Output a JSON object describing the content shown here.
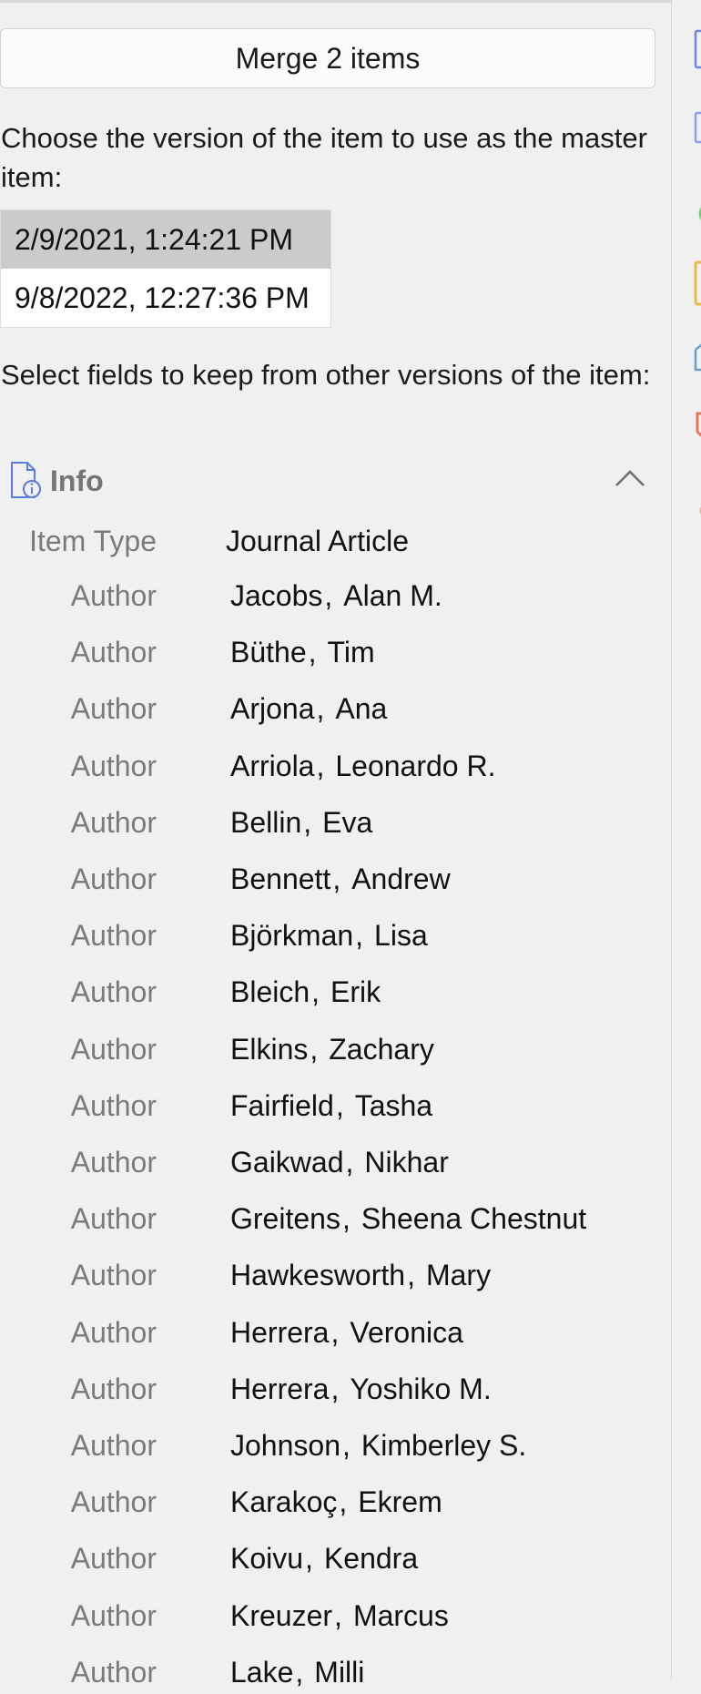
{
  "merge_button_label": "Merge 2 items",
  "master_prompt": "Choose the version of the item to use as the master item:",
  "versions": [
    {
      "label": "2/9/2021, 1:24:21 PM",
      "selected": true
    },
    {
      "label": "9/8/2022, 12:27:36 PM",
      "selected": false
    }
  ],
  "fields_prompt": "Select fields to keep from other versions of the item:",
  "info_section": {
    "title": "Info",
    "item_type_label": "Item Type",
    "item_type_value": "Journal Article",
    "author_label": "Author",
    "authors": [
      {
        "last": "Jacobs",
        "first": "Alan M."
      },
      {
        "last": "Büthe",
        "first": "Tim"
      },
      {
        "last": "Arjona",
        "first": "Ana"
      },
      {
        "last": "Arriola",
        "first": "Leonardo R."
      },
      {
        "last": "Bellin",
        "first": "Eva"
      },
      {
        "last": "Bennett",
        "first": "Andrew"
      },
      {
        "last": "Björkman",
        "first": "Lisa"
      },
      {
        "last": "Bleich",
        "first": "Erik"
      },
      {
        "last": "Elkins",
        "first": "Zachary"
      },
      {
        "last": "Fairfield",
        "first": "Tasha"
      },
      {
        "last": "Gaikwad",
        "first": "Nikhar"
      },
      {
        "last": "Greitens",
        "first": "Sheena Chestnut"
      },
      {
        "last": "Hawkesworth",
        "first": "Mary"
      },
      {
        "last": "Herrera",
        "first": "Veronica"
      },
      {
        "last": "Herrera",
        "first": "Yoshiko M."
      },
      {
        "last": "Johnson",
        "first": "Kimberley S."
      },
      {
        "last": "Karakoç",
        "first": "Ekrem"
      },
      {
        "last": "Koivu",
        "first": "Kendra"
      },
      {
        "last": "Kreuzer",
        "first": "Marcus"
      },
      {
        "last": "Lake",
        "first": "Milli"
      }
    ]
  },
  "colors": {
    "background": "#f0f0f0",
    "selected_version": "#cbcbcb",
    "label_gray": "#7a7a7a",
    "icon_blue": "#5b7be0"
  },
  "sidebar_icons": [
    "info-icon",
    "abstract-icon",
    "attachments-icon",
    "notes-icon",
    "libraries-collections-icon",
    "tags-icon",
    "related-icon"
  ]
}
